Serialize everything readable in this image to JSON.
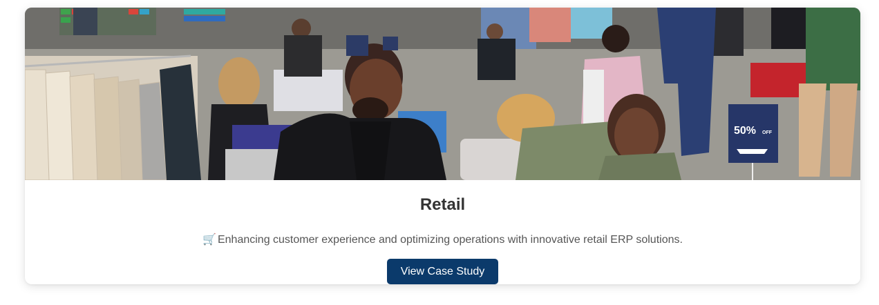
{
  "card": {
    "title": "Retail",
    "description_icon": "🛒",
    "description_icon_name": "shopping-cart-icon",
    "description": "Enhancing customer experience and optimizing operations with innovative retail ERP solutions.",
    "button_label": "View Case Study",
    "button_color": "#0b3a6b"
  },
  "hero_image": {
    "subject": "shoppers in a crowded clothing store",
    "sign_text": "50%",
    "sign_suffix": "OFF"
  }
}
